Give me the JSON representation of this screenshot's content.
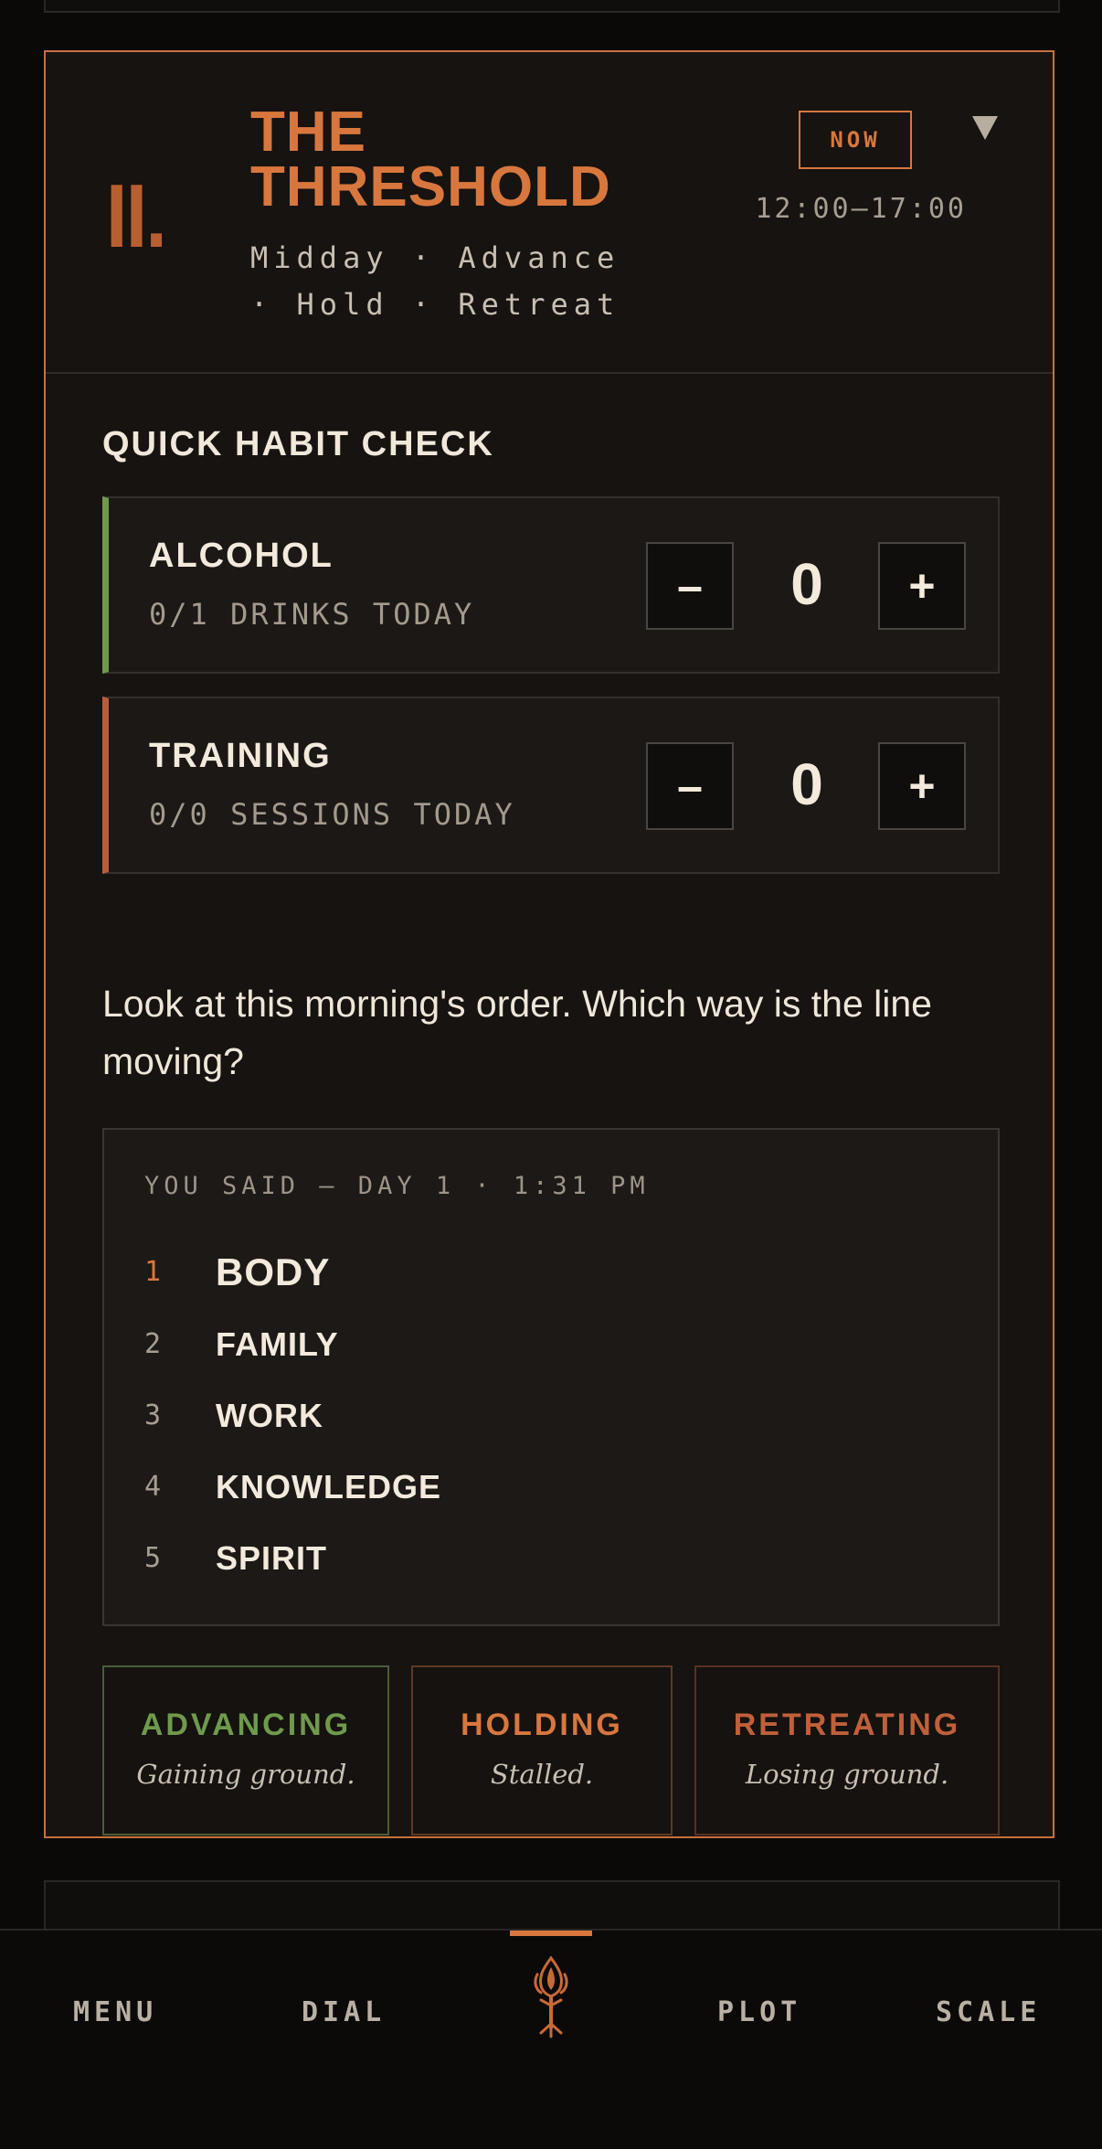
{
  "phase": {
    "numeral": "II.",
    "title": "THE THRESHOLD",
    "subtitle": "Midday · Advance · Hold · Retreat",
    "badge": "NOW",
    "time_range": "12:00–17:00",
    "collapse_icon": "triangle-down-icon"
  },
  "habit_check": {
    "title": "QUICK HABIT CHECK",
    "habits": [
      {
        "name": "ALCOHOL",
        "sub": "0/1 DRINKS TODAY",
        "value": "0",
        "minus": "–",
        "plus": "+",
        "accent": "#6f9a4c"
      },
      {
        "name": "TRAINING",
        "sub": "0/0 SESSIONS TODAY",
        "value": "0",
        "minus": "–",
        "plus": "+",
        "accent": "#b85f3a"
      }
    ]
  },
  "prompt": "Look at this morning's order. Which way is the line moving?",
  "you_said": {
    "caption": "YOU SAID — DAY 1 · 1:31 PM",
    "items": [
      {
        "rank": "1",
        "label": "BODY"
      },
      {
        "rank": "2",
        "label": "FAMILY"
      },
      {
        "rank": "3",
        "label": "WORK"
      },
      {
        "rank": "4",
        "label": "KNOWLEDGE"
      },
      {
        "rank": "5",
        "label": "SPIRIT"
      }
    ]
  },
  "directions": [
    {
      "label": "ADVANCING",
      "desc": "Gaining ground.",
      "color": "#6f9a4c"
    },
    {
      "label": "HOLDING",
      "desc": "Stalled.",
      "color": "#d8773d"
    },
    {
      "label": "RETREATING",
      "desc": "Losing ground.",
      "color": "#c0603a"
    }
  ],
  "nav": {
    "menu": "MENU",
    "dial": "DIAL",
    "home_icon": "flame-tree-icon",
    "plot": "PLOT",
    "scale": "SCALE"
  },
  "colors": {
    "accent": "#d8773d",
    "advance": "#6f9a4c",
    "retreat": "#c0603a",
    "background": "#0a0908",
    "card": "#161311"
  }
}
